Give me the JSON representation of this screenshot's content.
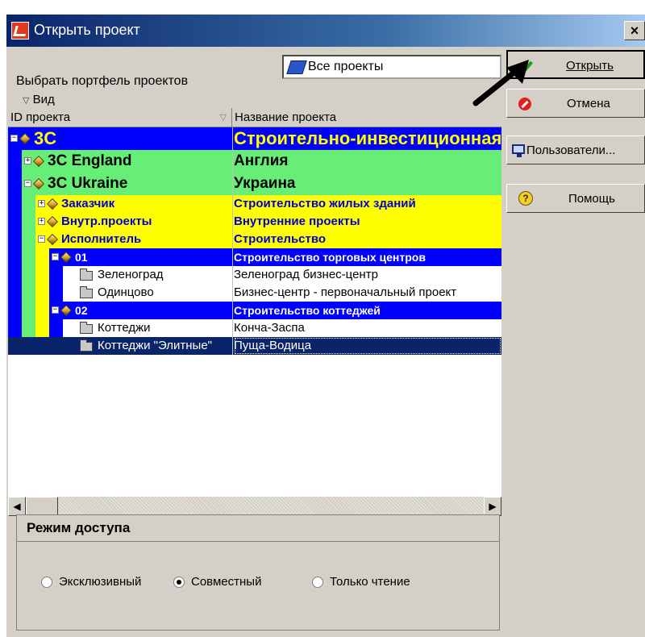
{
  "window": {
    "title": "Открыть проект",
    "close_label": "×"
  },
  "portfolio": {
    "label": "Выбрать портфель проектов",
    "value": "Все проекты"
  },
  "view": {
    "label": "Вид",
    "toggle_glyph": "▽"
  },
  "columns": {
    "id": "ID проекта",
    "name": "Название проекта"
  },
  "rows": [
    {
      "id": "3C",
      "name": "Строительно-инвестиционная компания",
      "level": 0,
      "kind": "node",
      "expander": "−",
      "color": "#0000ff"
    },
    {
      "id": "3C England",
      "name": "Англия",
      "level": 1,
      "kind": "node",
      "expander": "+",
      "color": "#66ee77"
    },
    {
      "id": "3C Ukraine",
      "name": "Украина",
      "level": 1,
      "kind": "node",
      "expander": "−",
      "color": "#66ee77"
    },
    {
      "id": "Заказчик",
      "name": "Строительство жилых зданий",
      "level": 2,
      "kind": "node",
      "expander": "+",
      "color": "#ffff00"
    },
    {
      "id": "Внутр.проекты",
      "name": "Внутренние проекты",
      "level": 2,
      "kind": "node",
      "expander": "+",
      "color": "#ffff00"
    },
    {
      "id": "Исполнитель",
      "name": "Строительство",
      "level": 2,
      "kind": "node",
      "expander": "−",
      "color": "#ffff00"
    },
    {
      "id": "01",
      "name": "Строительство торговых центров",
      "level": 3,
      "kind": "node",
      "expander": "−",
      "color": "#0000ff"
    },
    {
      "id": "Зеленоград",
      "name": "Зеленоград бизнес-центр",
      "level": 4,
      "kind": "project"
    },
    {
      "id": "Одинцово",
      "name": "Бизнес-центр - первоначальный проект",
      "level": 4,
      "kind": "project"
    },
    {
      "id": "02",
      "name": "Строительство коттеджей",
      "level": 3,
      "kind": "node",
      "expander": "−",
      "color": "#0000ff"
    },
    {
      "id": "Коттеджи",
      "name": "Конча-Заспа",
      "level": 4,
      "kind": "project"
    },
    {
      "id": "Коттеджи \"Элитные\"",
      "name": "Пуща-Водица",
      "level": 4,
      "kind": "project",
      "selected": true
    }
  ],
  "scroll": {
    "left_arrow": "◀",
    "right_arrow": "▶"
  },
  "access": {
    "title": "Режим доступа",
    "options": [
      {
        "label": "Эксклюзивный",
        "checked": false
      },
      {
        "label": "Совместный",
        "checked": true
      },
      {
        "label": "Только чтение",
        "checked": false
      }
    ]
  },
  "buttons": {
    "open": "Открыть",
    "cancel": "Отмена",
    "users": "Пользователи...",
    "help": "Помощь"
  },
  "colors": {
    "title_bar": "#0a246a",
    "selection": "#0a246a",
    "level0": "#0000ff",
    "level1": "#66ee77",
    "level2": "#ffff00",
    "level3": "#0000ff"
  }
}
